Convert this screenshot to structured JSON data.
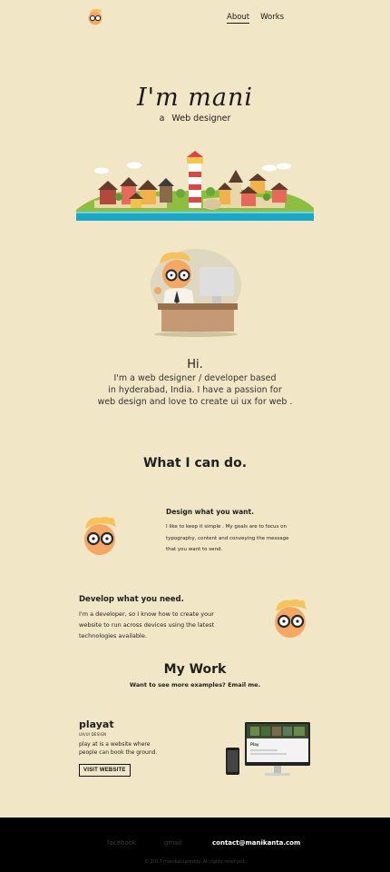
{
  "header": {
    "logo_icon": "mani-face-logo-icon",
    "nav": [
      {
        "label": "About",
        "active": true
      },
      {
        "label": "Works",
        "active": false
      }
    ]
  },
  "hero": {
    "title": "I'm mani",
    "subtitle_article": "a",
    "subtitle": "Web designer",
    "illustration": "village-island-with-lighthouse"
  },
  "intro": {
    "illustration": "mani-at-desk-with-computer",
    "greeting": "Hi.",
    "line1": "I'm a web designer / developer based",
    "line2": "in hyderabad, India. I have a passion for",
    "line3": "web design and love to create ui ux for web ."
  },
  "skills": {
    "title": "What I can do.",
    "items": [
      {
        "title": "Design what you want.",
        "lines": [
          "I like to keep it simple . My goals are to focus on",
          "typography, content and conveying the message",
          "that you want to send."
        ]
      },
      {
        "title": "Develop what you need.",
        "lines": [
          "I'm a developer, so I know how to create your",
          "website to run across devices using the latest",
          "technologies available."
        ]
      }
    ]
  },
  "work": {
    "title": "My Work",
    "subtitle": "Want to see more examples? Email me.",
    "project": {
      "name": "playat",
      "category": "UX/UI DESIGN",
      "desc1": "play at is a website where",
      "desc2": "people can book the ground.",
      "button": "VISIT WEBSITE",
      "screen_brand": "Play"
    }
  },
  "footer": {
    "links": [
      "facebook",
      "gmail"
    ],
    "contact": "contact@manikanta.com",
    "copyright": "© 2017 manikantareddy. All rights reserved."
  },
  "colors": {
    "background": "#f1e6c5",
    "footer": "#000000",
    "water": "#1aa7c8",
    "grass": "#8cbf3f"
  }
}
